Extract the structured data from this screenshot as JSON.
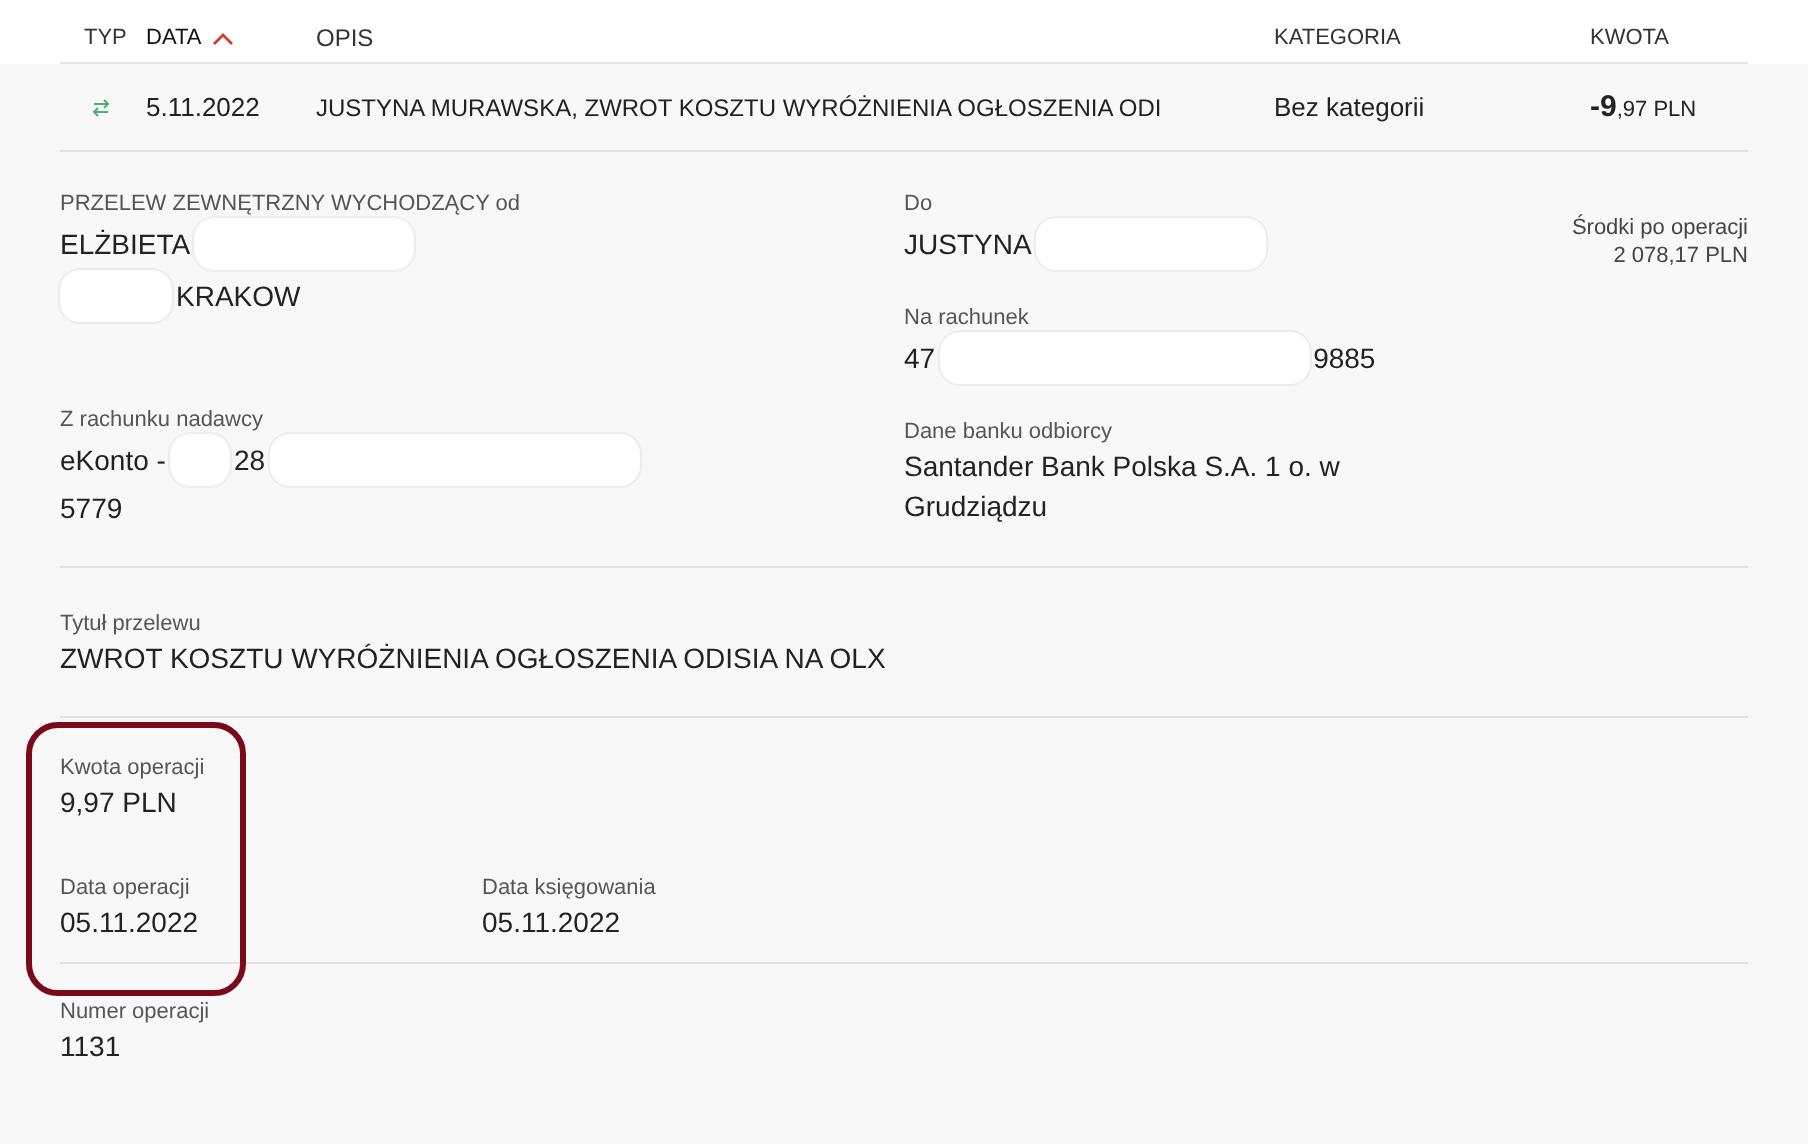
{
  "table": {
    "columns": [
      {
        "label": "TYP",
        "sorted": false
      },
      {
        "label": "DATA",
        "sorted": true
      },
      {
        "label": "OPIS",
        "sorted": false
      },
      {
        "label": "KATEGORIA",
        "sorted": false
      },
      {
        "label": "KWOTA",
        "sorted": false
      }
    ],
    "row": {
      "kind": "transfer",
      "date": "5.11.2022",
      "description": "JUSTYNA MURAWSKA, ZWROT KOSZTU WYRÓŻNIENIA OGŁOSZENIA ODI",
      "category": "Bez kategorii",
      "amount": "**-9**,97 PLN"
    }
  },
  "details": {
    "sender": {
      "label": "PRZELEW ZEWNĘTRZNY WYCHODZĄCY od",
      "lines": [
        [
          {
            "kind": "text",
            "text": "ELŻBIETA"
          },
          {
            "kind": "redacted"
          }
        ],
        [
          {
            "kind": "redacted"
          },
          {
            "kind": "text",
            "text": "KRAKOW"
          }
        ]
      ]
    },
    "sender_account": {
      "label": "Z rachunku nadawcy",
      "lines": [
        [
          {
            "kind": "text",
            "text": "eKonto -"
          },
          {
            "kind": "redacted"
          },
          {
            "kind": "text",
            "text": "28"
          },
          {
            "kind": "redacted"
          }
        ],
        [
          {
            "kind": "text",
            "text": "5779"
          }
        ]
      ]
    },
    "recipient": {
      "label": "Do",
      "lines": [
        [
          {
            "kind": "text",
            "text": "JUSTYNA"
          },
          {
            "kind": "redacted"
          }
        ]
      ]
    },
    "recipient_account": {
      "label": "Na rachunek",
      "lines": [
        [
          {
            "kind": "text",
            "text": "47"
          },
          {
            "kind": "redacted"
          },
          {
            "kind": "text",
            "text": "9885"
          }
        ]
      ]
    },
    "recipient_bank": {
      "label": "Dane banku odbiorcy",
      "value": "Santander Bank Polska S.A. 1 o. w Grudziądzu"
    },
    "balance": {
      "label": "Środki po operacji",
      "value": "2 078,17 PLN"
    },
    "title": {
      "label": "Tytuł przelewu",
      "value": "ZWROT KOSZTU WYRÓŻNIENIA OGŁOSZENIA ODISIA NA OLX"
    },
    "amount": {
      "label": "Kwota operacji",
      "value": "9,97 PLN"
    },
    "operation_date": {
      "label": "Data operacji",
      "value": "05.11.2022"
    },
    "posting_date": {
      "label": "Data księgowania",
      "value": "05.11.2022"
    },
    "operation_number": {
      "label": "Numer operacji",
      "value": "1131"
    },
    "highlighted": true
  }
}
